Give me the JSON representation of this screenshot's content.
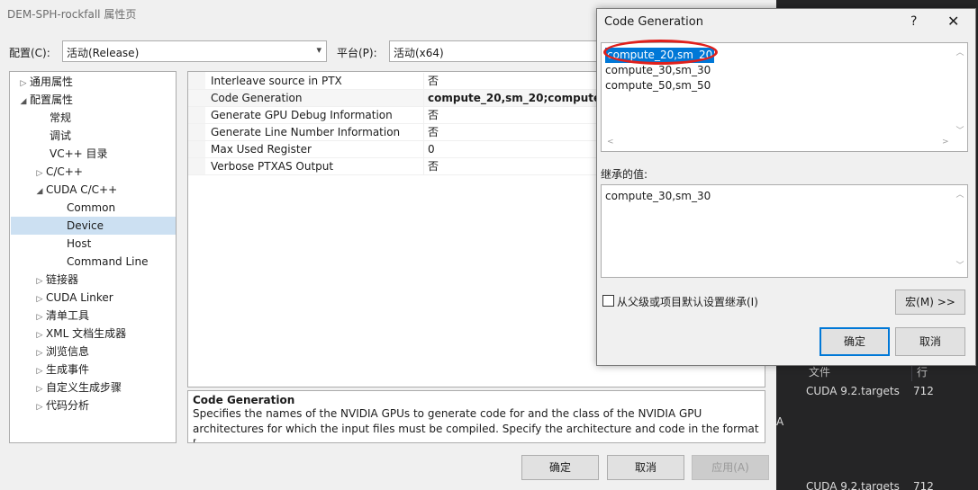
{
  "window": {
    "title": "DEM-SPH-rockfall 属性页",
    "config_label": "配置(C):",
    "config_value": "活动(Release)",
    "platform_label": "平台(P):",
    "platform_value": "活动(x64)"
  },
  "tree": {
    "items": [
      {
        "label": "通用属性",
        "toggle": "▷"
      },
      {
        "label": "配置属性",
        "toggle": "◢"
      },
      {
        "label": "常规",
        "toggle": ""
      },
      {
        "label": "调试",
        "toggle": ""
      },
      {
        "label": "VC++ 目录",
        "toggle": ""
      },
      {
        "label": "C/C++",
        "toggle": "▷"
      },
      {
        "label": "CUDA C/C++",
        "toggle": "◢"
      },
      {
        "label": "Common",
        "toggle": ""
      },
      {
        "label": "Device",
        "toggle": ""
      },
      {
        "label": "Host",
        "toggle": ""
      },
      {
        "label": "Command Line",
        "toggle": ""
      },
      {
        "label": "链接器",
        "toggle": "▷"
      },
      {
        "label": "CUDA Linker",
        "toggle": "▷"
      },
      {
        "label": "清单工具",
        "toggle": "▷"
      },
      {
        "label": "XML 文档生成器",
        "toggle": "▷"
      },
      {
        "label": "浏览信息",
        "toggle": "▷"
      },
      {
        "label": "生成事件",
        "toggle": "▷"
      },
      {
        "label": "自定义生成步骤",
        "toggle": "▷"
      },
      {
        "label": "代码分析",
        "toggle": "▷"
      }
    ]
  },
  "grid": {
    "rows": [
      {
        "name": "Interleave source in PTX",
        "value": "否"
      },
      {
        "name": "Code Generation",
        "value": "compute_20,sm_20;compute_30"
      },
      {
        "name": "Generate GPU Debug Information",
        "value": "否"
      },
      {
        "name": "Generate Line Number Information",
        "value": "否"
      },
      {
        "name": "Max Used Register",
        "value": "0"
      },
      {
        "name": "Verbose PTXAS Output",
        "value": "否"
      }
    ]
  },
  "description": {
    "heading": "Code Generation",
    "text": "Specifies the names of the NVIDIA GPUs to generate code for and the class of the NVIDIA GPU architectures for which the input files must be compiled.  Specify the architecture and code in the format [..."
  },
  "buttons": {
    "ok": "确定",
    "cancel": "取消",
    "apply": "应用(A)"
  },
  "dialog": {
    "title": "Code Generation",
    "help": "?",
    "close": "✕",
    "values": [
      "compute_20,sm_20",
      "compute_30,sm_30",
      "compute_50,sm_50"
    ],
    "inherited_label": "继承的值:",
    "inherited_values": [
      "compute_30,sm_30"
    ],
    "inherit_checkbox_label": "从父级或项目默认设置继承(I)",
    "macros_button": "宏(M) >>",
    "ok": "确定",
    "cancel": "取消"
  },
  "background_panel": {
    "col_file": "文件",
    "col_line": "行",
    "rows": [
      {
        "file": "CUDA 9.2.targets",
        "line": "712"
      },
      {
        "file": "CUDA 9.2.targets",
        "line": "712"
      }
    ],
    "fragment": "A"
  }
}
